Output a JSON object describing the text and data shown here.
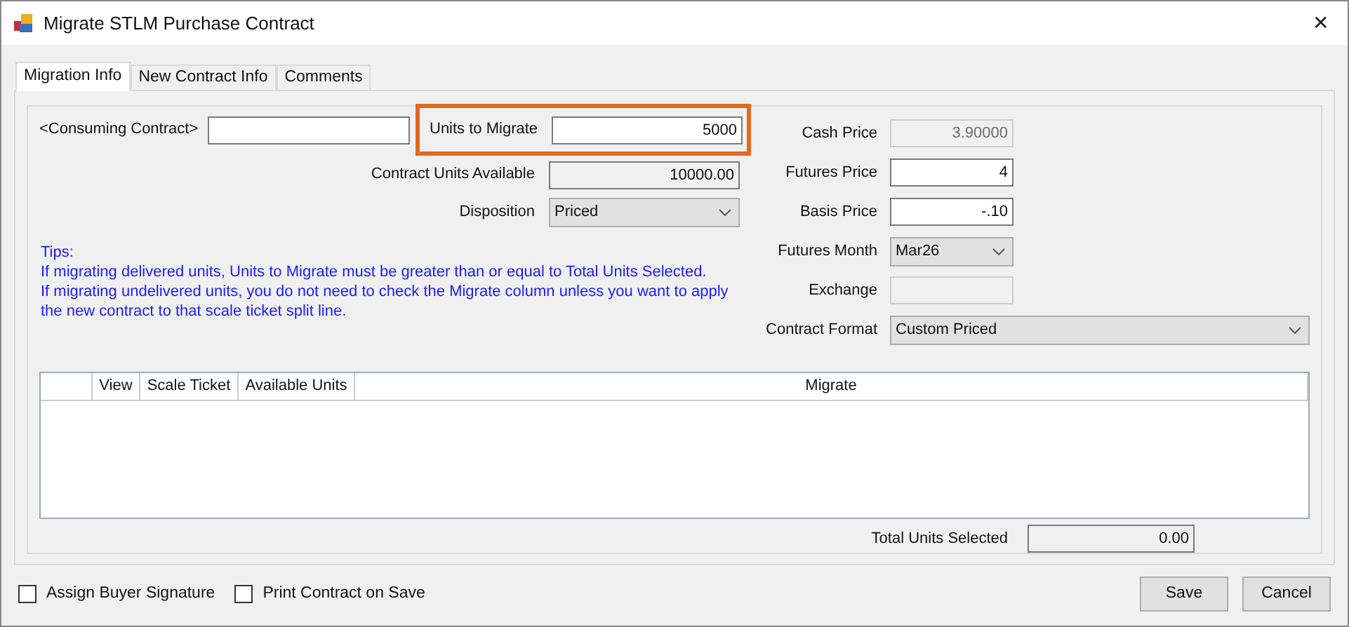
{
  "window": {
    "title": "Migrate STLM Purchase Contract",
    "close": "✕"
  },
  "tabs": [
    {
      "label": "Migration Info",
      "selected": true
    },
    {
      "label": "New Contract Info",
      "selected": false
    },
    {
      "label": "Comments",
      "selected": false
    }
  ],
  "consuming_contract": {
    "label": "<Consuming Contract>"
  },
  "left_fields": [
    {
      "label": "Units to Migrate",
      "kind": "text",
      "value": "5000",
      "disabled": false,
      "highlighted": true
    },
    {
      "label": "Contract Units Available",
      "kind": "readonly",
      "value": "10000.00",
      "disabled": false,
      "highlighted": false
    },
    {
      "label": "Disposition",
      "kind": "dropdown",
      "value": "Priced",
      "disabled": false,
      "highlighted": false
    }
  ],
  "right_fields": [
    {
      "label": "Cash Price",
      "kind": "text",
      "value": "3.90000",
      "disabled": true
    },
    {
      "label": "Futures Price",
      "kind": "text",
      "value": "4",
      "disabled": false
    },
    {
      "label": "Basis Price",
      "kind": "text",
      "value": "-.10",
      "disabled": false
    },
    {
      "label": "Futures Month",
      "kind": "dropdown",
      "value": "Mar26",
      "disabled": false
    },
    {
      "label": "Exchange",
      "kind": "text",
      "disabled": true
    },
    {
      "label": "Contract Format",
      "kind": "wide_dropdown",
      "value": "Custom Priced",
      "disabled": false
    }
  ],
  "tips": [
    "Tips:",
    "If migrating delivered units, Units to Migrate must be greater than or equal to Total Units Selected.",
    "If migrating undelivered units, you do not need to check the Migrate column unless you want to apply",
    "the new contract to that scale ticket split line."
  ],
  "table": {
    "columns": [
      "View",
      "Scale Ticket",
      "Available Units",
      "Migrate"
    ]
  },
  "total_units_selected": {
    "label": "Total Units Selected",
    "value": "0.00"
  },
  "checkboxes": [
    {
      "label": "Assign Buyer Signature",
      "checked": false
    },
    {
      "label": "Print Contract on Save",
      "checked": false
    }
  ],
  "buttons": [
    "Save",
    "Cancel"
  ]
}
